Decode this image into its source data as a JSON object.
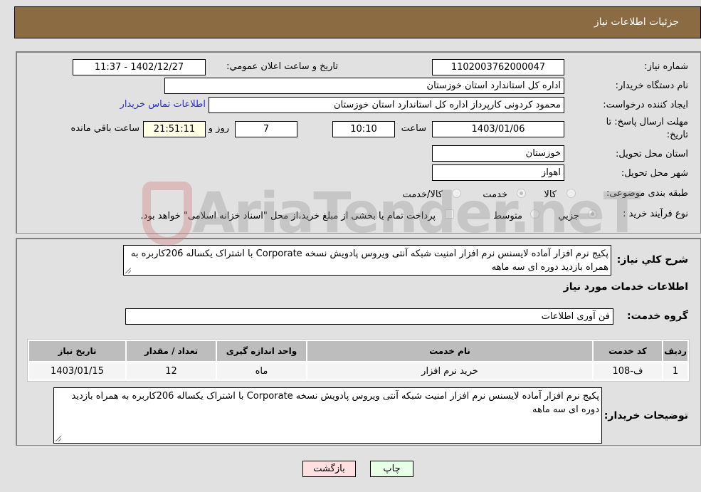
{
  "header": {
    "title": "جزئیات اطلاعات نیاز"
  },
  "form": {
    "need_number_label": "شماره نیاز:",
    "need_number": "1102003762000047",
    "announce_label": "تاريخ و ساعت اعلان عمومي:",
    "announce_value": "1402/12/27 - 11:37",
    "buyer_org_label": "نام دستگاه خريدار:",
    "buyer_org": "اداره کل استاندارد استان خوزستان",
    "creator_label": "ايجاد کننده درخواست:",
    "creator": "محمود کردونی کارپرداز اداره کل استاندارد استان خوزستان",
    "contact_link": "اطلاعات تماس خريدار",
    "deadline_label_line1": "مهلت ارسال پاسخ: تا",
    "deadline_label_line2": "تاريخ:",
    "deadline_date": "1403/01/06",
    "time_label": "ساعت",
    "deadline_time": "10:10",
    "days_value": "7",
    "days_label": "روز و",
    "remaining_time": "21:51:11",
    "remaining_label": "ساعت باقي مانده",
    "province_label": "استان محل تحويل:",
    "province": "خوزستان",
    "city_label": "شهر محل تحويل:",
    "city": "اهواز",
    "category_label": "طبقه بندی موضوعی:",
    "category_options": [
      {
        "label": "کالا",
        "checked": false
      },
      {
        "label": "خدمت",
        "checked": true
      },
      {
        "label": "کالا/خدمت",
        "checked": false
      }
    ],
    "process_label": "نوع فرآيند خريد :",
    "process_options": [
      {
        "label": "جزيي",
        "checked": true
      },
      {
        "label": "متوسط",
        "checked": false
      }
    ],
    "treasury_note": "پرداخت تمام يا بخشی از مبلغ خريد،از محل \"اسناد خزانه اسلامی\" خواهد بود."
  },
  "details": {
    "description_label": "شرح کلي نياز:",
    "description": "پکیج نرم افزار آماده لایسنس نرم افزار امنیت شبکه آنتی ویروس پادویش نسخه  Corporate با اشتراک یکساله 206کاربره به همراه بازدید دوره ای سه ماهه",
    "services_heading": "اطلاعات خدمات مورد نياز",
    "service_group_label": "گروه خدمت:",
    "service_group": "فن آوری اطلاعات",
    "table": {
      "headers": [
        "رديف",
        "کد خدمت",
        "نام خدمت",
        "واحد اندازه گيری",
        "تعداد / مقدار",
        "تاريخ نياز"
      ],
      "rows": [
        [
          "1",
          "ف-108",
          "خريد نرم افزار",
          "ماه",
          "12",
          "1403/01/15"
        ]
      ]
    },
    "buyer_notes_label": "توضيحات خريدار:",
    "buyer_notes": "پکیج نرم افزار آماده لایسنس نرم افزار امنیت شبکه آنتی ویروس پادویش نسخه  Corporate با اشتراک یکساله  206کاربره به همراه بازدید دوره ای سه ماهه"
  },
  "buttons": {
    "print": "چاپ",
    "back": "بازگشت"
  },
  "watermark": {
    "text": "AriaTender.neT"
  }
}
